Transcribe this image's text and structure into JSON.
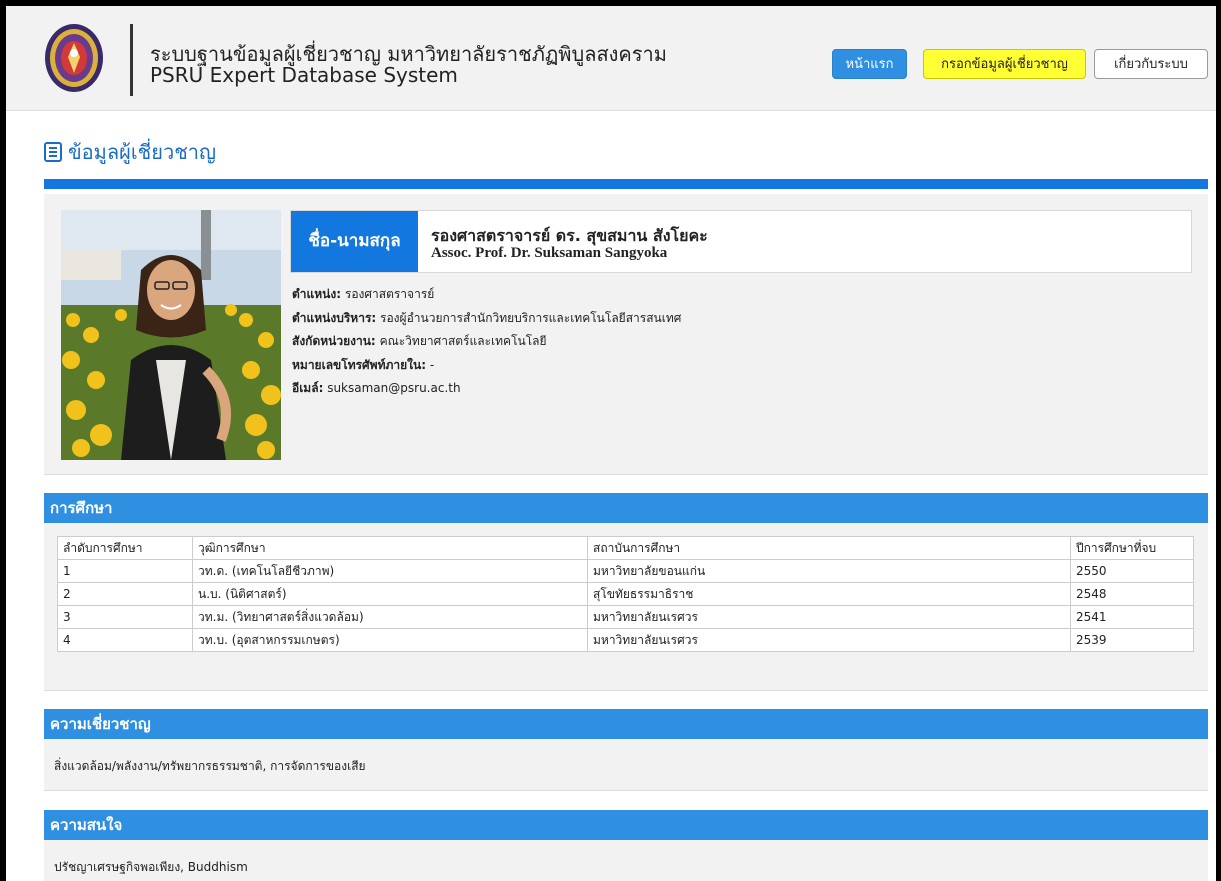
{
  "header": {
    "title_th": "ระบบฐานข้อมูลผู้เชี่ยวชาญ มหาวิทยาลัยราชภัฏพิบูลสงคราม",
    "title_en": "PSRU Expert Database System",
    "nav": {
      "home": "หน้าแรก",
      "enter_expert": "กรอกข้อมูลผู้เชี่ยวชาญ",
      "about": "เกี่ยวกับระบบ"
    }
  },
  "page_title": "ข้อมูลผู้เชี่ยวชาญ",
  "profile": {
    "name_label": "ชื่อ-นามสกุล",
    "name_th": "รองศาสตราจารย์ ดร. สุขสมาน สังโยคะ",
    "name_en": "Assoc. Prof. Dr. Suksaman Sangyoka",
    "position_label": "ตำแหน่ง:",
    "position": "รองศาสตราจารย์",
    "admin_position_label": "ตำแหน่งบริหาร:",
    "admin_position": "รองผู้อำนวยการสำนักวิทยบริการและเทคโนโลยีสารสนเทศ",
    "affiliation_label": "สังกัดหน่วยงาน:",
    "affiliation": "คณะวิทยาศาสตร์และเทคโนโลยี",
    "phone_label": "หมายเลขโทรศัพท์ภายใน:",
    "phone": "-",
    "email_label": "อีเมล์:",
    "email": "suksaman@psru.ac.th"
  },
  "education": {
    "heading": "การศึกษา",
    "columns": [
      "ลำดับการศึกษา",
      "วุฒิการศึกษา",
      "สถาบันการศึกษา",
      "ปีการศึกษาที่จบ"
    ],
    "rows": [
      [
        "1",
        "วท.ด. (เทคโนโลยีชีวภาพ)",
        "มหาวิทยาลัยขอนแก่น",
        "2550"
      ],
      [
        "2",
        "น.บ. (นิติศาสตร์)",
        "สุโขทัยธรรมาธิราช",
        "2548"
      ],
      [
        "3",
        "วท.ม. (วิทยาศาสตร์สิ่งแวดล้อม)",
        "มหาวิทยาลัยนเรศวร",
        "2541"
      ],
      [
        "4",
        "วท.บ. (อุตสาหกรรมเกษตร)",
        "มหาวิทยาลัยนเรศวร",
        "2539"
      ]
    ]
  },
  "expertise": {
    "heading": "ความเชี่ยวชาญ",
    "text": "สิ่งแวดล้อม/พลังงาน/ทรัพยากรธรรมชาติ, การจัดการของเสีย"
  },
  "interests": {
    "heading": "ความสนใจ",
    "text": "ปรัชญาเศรษฐกิจพอเพียง, Buddhism"
  },
  "colors": {
    "accent": "#1278e0",
    "section_header": "#2f8fe0",
    "highlight_button": "#ffff33"
  }
}
